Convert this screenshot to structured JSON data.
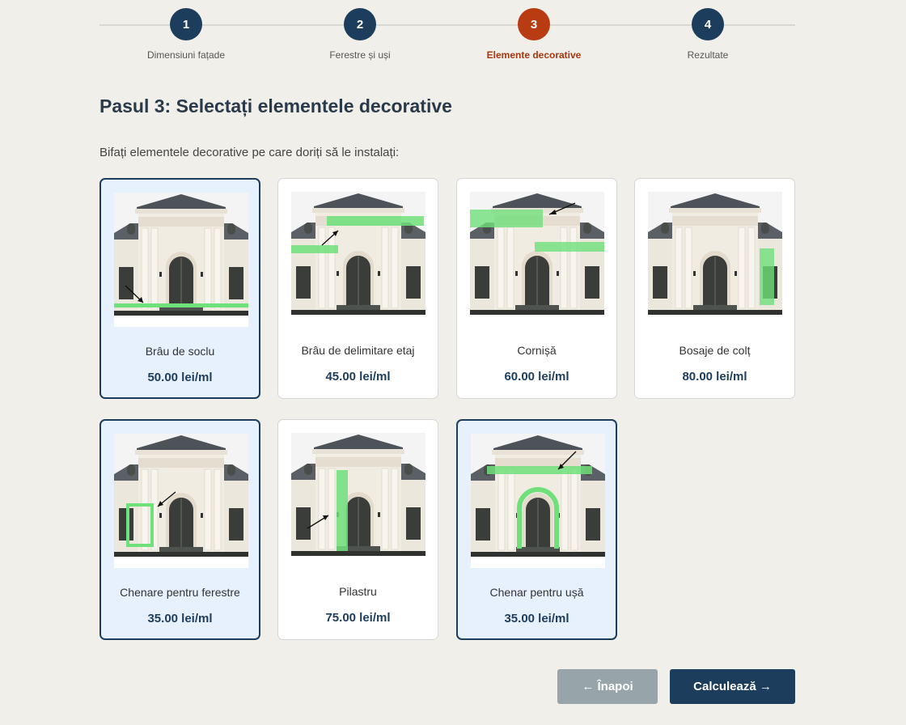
{
  "stepper": {
    "steps": [
      {
        "number": "1",
        "label": "Dimensiuni fațade"
      },
      {
        "number": "2",
        "label": "Ferestre și uși"
      },
      {
        "number": "3",
        "label": "Elemente decorative"
      },
      {
        "number": "4",
        "label": "Rezultate"
      }
    ],
    "active_step": 3
  },
  "page": {
    "title": "Pasul 3: Selectați elementele decorative",
    "instructions": "Bifați elementele decorative pe care doriți să le instalați:"
  },
  "elements": [
    {
      "name": "Brâu de soclu",
      "price": "50.00 lei/ml",
      "selected": true
    },
    {
      "name": "Brâu de delimitare etaj",
      "price": "45.00 lei/ml",
      "selected": false
    },
    {
      "name": "Cornișă",
      "price": "60.00 lei/ml",
      "selected": false
    },
    {
      "name": "Bosaje de colț",
      "price": "80.00 lei/ml",
      "selected": false
    },
    {
      "name": "Chenare pentru ferestre",
      "price": "35.00 lei/ml",
      "selected": true
    },
    {
      "name": "Pilastru",
      "price": "75.00 lei/ml",
      "selected": false
    },
    {
      "name": "Chenar pentru ușă",
      "price": "35.00 lei/ml",
      "selected": true
    }
  ],
  "buttons": {
    "back_label": "← Înapoi",
    "calculate_label": "Calculează →"
  },
  "colors": {
    "primary": "#1d3d5c",
    "active_step": "#b83b12",
    "selected_card_bg": "#e6f1fd",
    "highlight": "#6fe07a",
    "back_button": "#97a5ab"
  }
}
